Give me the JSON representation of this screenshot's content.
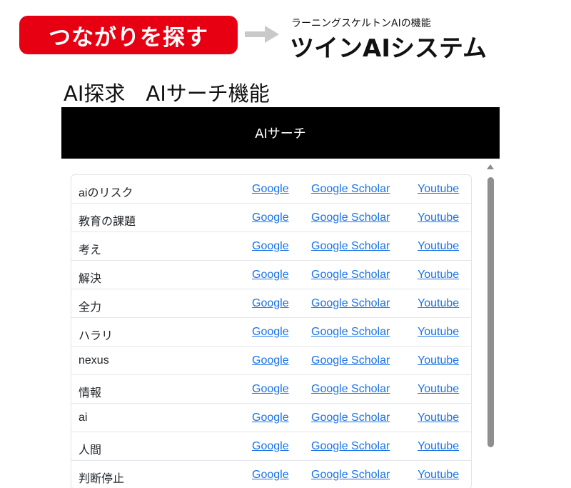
{
  "banner": {
    "pill_text": "つながりを探す",
    "subtitle": "ラーニングスケルトンAIの機能",
    "headline": "ツインAIシステム"
  },
  "section_title": "AI探求　AIサーチ機能",
  "panel": {
    "header_title": "AIサーチ",
    "link_labels": {
      "google": "Google",
      "scholar": "Google Scholar",
      "youtube": "Youtube"
    },
    "rows": [
      {
        "term": "aiのリスク"
      },
      {
        "term": "教育の課題"
      },
      {
        "term": "考え"
      },
      {
        "term": "解決"
      },
      {
        "term": "全力"
      },
      {
        "term": "ハラリ"
      },
      {
        "term": "nexus"
      },
      {
        "term": "情報"
      },
      {
        "term": "ai"
      },
      {
        "term": "人間"
      },
      {
        "term": "判断停止"
      }
    ]
  },
  "colors": {
    "pill": "#e60012",
    "link": "#1a73e8",
    "header_bg": "#000000"
  }
}
